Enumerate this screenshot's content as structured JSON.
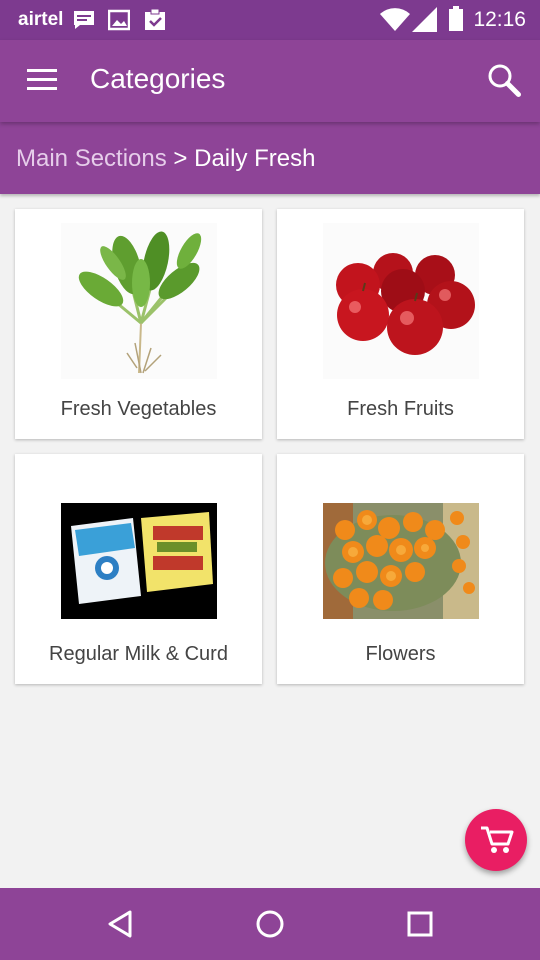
{
  "status_bar": {
    "carrier": "airtel",
    "time": "12:16",
    "icons": [
      "message-icon",
      "image-icon",
      "clipboard-check-icon",
      "wifi-icon",
      "signal-icon",
      "battery-icon"
    ]
  },
  "app_bar": {
    "title": "Categories",
    "menu_icon": "menu-icon",
    "search_icon": "search-icon"
  },
  "breadcrumb": {
    "parent": "Main Sections",
    "separator": ">",
    "current": "Daily Fresh"
  },
  "categories": [
    {
      "label": "Fresh Vegetables",
      "image": "leafy-vegetable-image"
    },
    {
      "label": "Fresh Fruits",
      "image": "apples-image"
    },
    {
      "label": "Regular Milk & Curd",
      "image": "milk-packets-image"
    },
    {
      "label": "Flowers",
      "image": "marigold-flowers-image"
    }
  ],
  "fab": {
    "icon": "cart-icon"
  },
  "nav_bar": {
    "icons": [
      "back-icon",
      "home-icon",
      "recents-icon"
    ]
  },
  "colors": {
    "primary": "#8e4497",
    "status_bar": "#7d3a8f",
    "accent": "#e91e63",
    "background": "#f2f2f2"
  }
}
